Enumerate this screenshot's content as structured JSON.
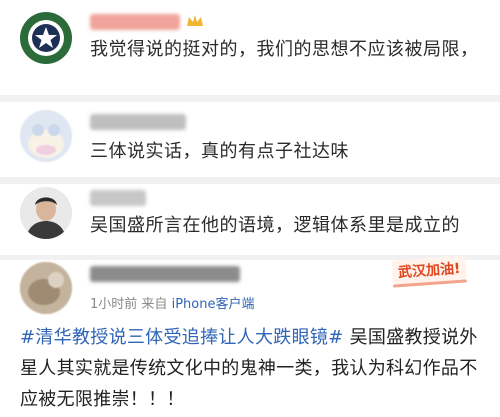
{
  "comments": [
    {
      "name": "(blurred)",
      "text": "我觉得说的挺对的，我们的思想不应该被局限，"
    },
    {
      "name": "(blurred)",
      "text": "三体说实话，真的有点子社达味"
    },
    {
      "name": "(blurred)",
      "text": "吴国盛所言在他的语境，逻辑体系里是成立的"
    }
  ],
  "post": {
    "time": "1小时前",
    "from": "来自",
    "source": "iPhone客户端",
    "badge": "武汉加油!",
    "hashtag": "#清华教授说三体受追捧让人大跌眼镜#",
    "body": " 吴国盛教授说外星人其实就是传统文化中的鬼神一类，我认为科幻作品不应被无限推崇！！！"
  },
  "colors": {
    "link": "#2f64b6",
    "accent": "#e0461f",
    "separator": "#f1f1f1"
  }
}
